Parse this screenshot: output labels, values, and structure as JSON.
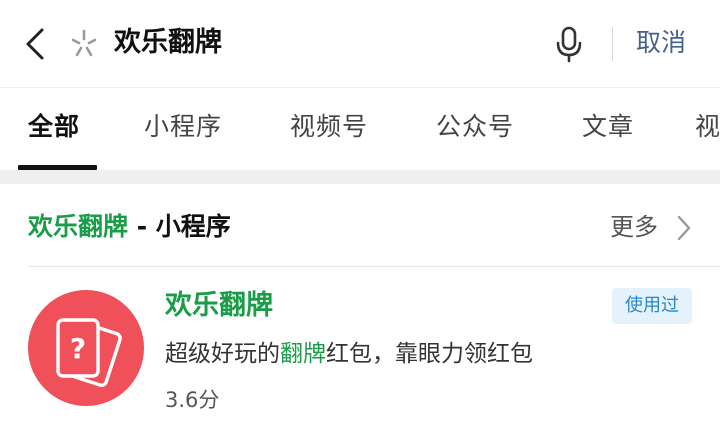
{
  "search": {
    "query": "欢乐翻牌",
    "cancel_label": "取消"
  },
  "icons": {
    "back": "chevron-left-icon",
    "spark": "wechat-search-spark-icon",
    "mic": "microphone-icon",
    "more": "chevron-right-icon",
    "app": "question-card-icon"
  },
  "tabs": [
    {
      "label": "全部",
      "active": true
    },
    {
      "label": "小程序",
      "active": false
    },
    {
      "label": "视频号",
      "active": false
    },
    {
      "label": "公众号",
      "active": false
    },
    {
      "label": "文章",
      "active": false
    },
    {
      "label": "视",
      "active": false
    }
  ],
  "section": {
    "title_highlight": "欢乐翻牌",
    "title_rest": " - 小程序",
    "more_label": "更多"
  },
  "result": {
    "name": "欢乐翻牌",
    "badge": "使用过",
    "desc_before": "超级好玩的",
    "desc_keyword": "翻牌",
    "desc_after": "红包，靠眼力领红包",
    "rating": "3.6分"
  },
  "colors": {
    "highlight": "#1a9c48",
    "cancel": "#48608e",
    "icon_bg": "#f0505a",
    "badge_bg": "#e4f2fb",
    "badge_text": "#2a86c8"
  }
}
